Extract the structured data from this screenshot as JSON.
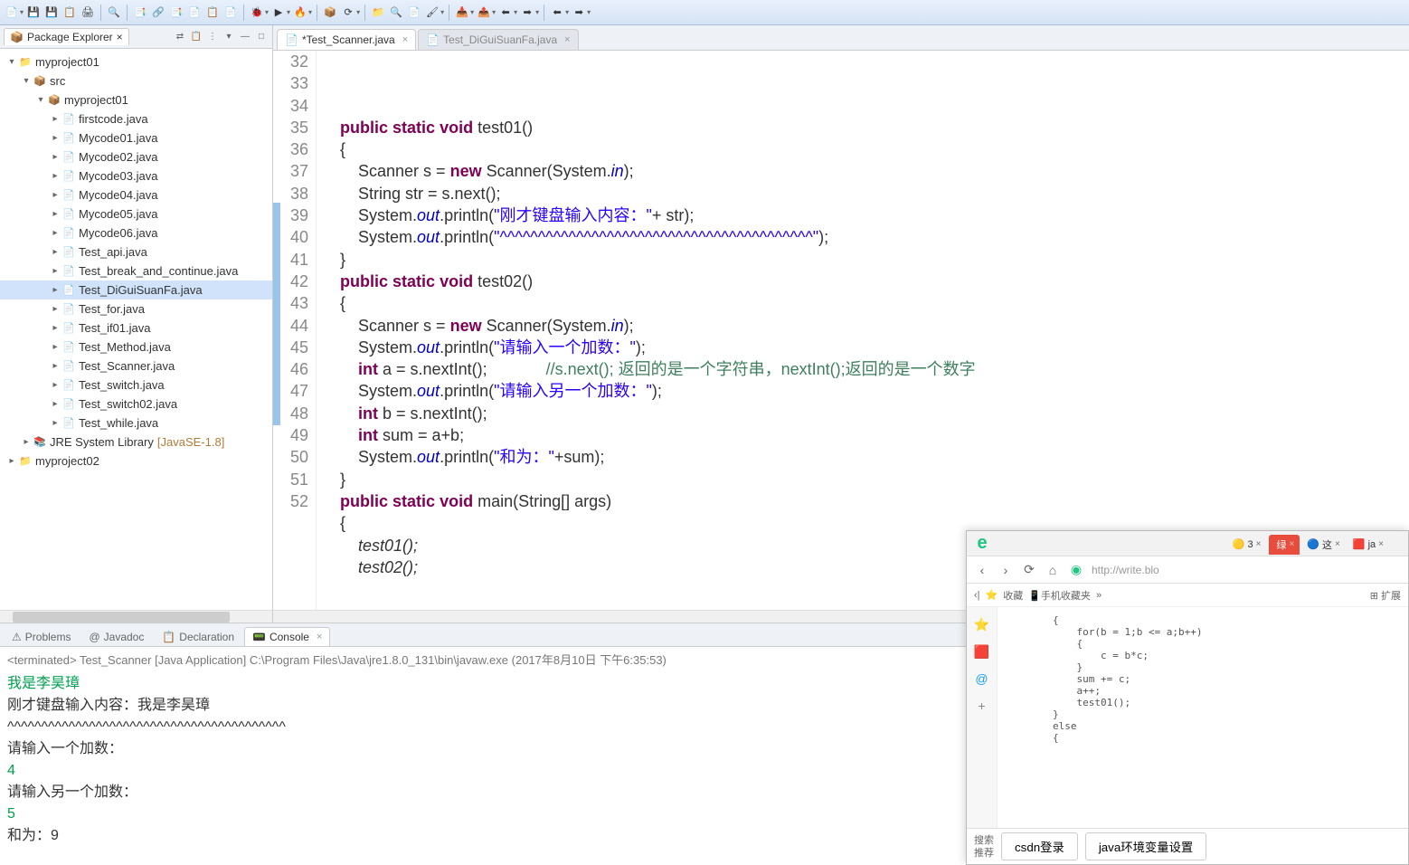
{
  "toolbar_icons": [
    "📄",
    "▾",
    "💾",
    "💾",
    "📋",
    "🖨",
    "",
    "🔍",
    "",
    "📑",
    "🔗",
    "📑",
    "📄",
    "📋",
    "📄",
    "",
    "🐞",
    "▾",
    "▶",
    "▾",
    "🔥",
    "▾",
    "",
    "📦",
    "⟳",
    "▾",
    "",
    "📁",
    "🔍",
    "📄",
    "🖌",
    "▾",
    "",
    "📥",
    "▾",
    "📤",
    "▾",
    "⬅",
    "▾",
    "➡",
    "▾",
    "",
    "⬅",
    "▾",
    "➡",
    "▾"
  ],
  "packageExplorer": {
    "title": "Package Explorer",
    "tools": [
      "⇄",
      "📋",
      "⋮",
      "▾",
      "—",
      "□"
    ]
  },
  "tree": [
    {
      "d": 0,
      "tw": "▾",
      "ic": "📁",
      "cls": "proj",
      "lbl": "myproject01"
    },
    {
      "d": 1,
      "tw": "▾",
      "ic": "📦",
      "cls": "pkg",
      "lbl": "src"
    },
    {
      "d": 2,
      "tw": "▾",
      "ic": "📦",
      "cls": "pkg",
      "lbl": "myproject01"
    },
    {
      "d": 3,
      "tw": "▸",
      "ic": "📄",
      "cls": "java",
      "lbl": "firstcode.java"
    },
    {
      "d": 3,
      "tw": "▸",
      "ic": "📄",
      "cls": "java",
      "lbl": "Mycode01.java"
    },
    {
      "d": 3,
      "tw": "▸",
      "ic": "📄",
      "cls": "java",
      "lbl": "Mycode02.java"
    },
    {
      "d": 3,
      "tw": "▸",
      "ic": "📄",
      "cls": "java",
      "lbl": "Mycode03.java"
    },
    {
      "d": 3,
      "tw": "▸",
      "ic": "📄",
      "cls": "java",
      "lbl": "Mycode04.java"
    },
    {
      "d": 3,
      "tw": "▸",
      "ic": "📄",
      "cls": "java",
      "lbl": "Mycode05.java"
    },
    {
      "d": 3,
      "tw": "▸",
      "ic": "📄",
      "cls": "java",
      "lbl": "Mycode06.java"
    },
    {
      "d": 3,
      "tw": "▸",
      "ic": "📄",
      "cls": "java",
      "lbl": "Test_api.java"
    },
    {
      "d": 3,
      "tw": "▸",
      "ic": "📄",
      "cls": "java",
      "lbl": "Test_break_and_continue.java"
    },
    {
      "d": 3,
      "tw": "▸",
      "ic": "📄",
      "cls": "java",
      "lbl": "Test_DiGuiSuanFa.java",
      "sel": true
    },
    {
      "d": 3,
      "tw": "▸",
      "ic": "📄",
      "cls": "java",
      "lbl": "Test_for.java"
    },
    {
      "d": 3,
      "tw": "▸",
      "ic": "📄",
      "cls": "java",
      "lbl": "Test_if01.java"
    },
    {
      "d": 3,
      "tw": "▸",
      "ic": "📄",
      "cls": "java",
      "lbl": "Test_Method.java"
    },
    {
      "d": 3,
      "tw": "▸",
      "ic": "📄",
      "cls": "java",
      "lbl": "Test_Scanner.java"
    },
    {
      "d": 3,
      "tw": "▸",
      "ic": "📄",
      "cls": "java",
      "lbl": "Test_switch.java"
    },
    {
      "d": 3,
      "tw": "▸",
      "ic": "📄",
      "cls": "java",
      "lbl": "Test_switch02.java"
    },
    {
      "d": 3,
      "tw": "▸",
      "ic": "📄",
      "cls": "java",
      "lbl": "Test_while.java"
    },
    {
      "d": 1,
      "tw": "▸",
      "ic": "📚",
      "cls": "lib",
      "lbl": "JRE System Library",
      "suffix": "[JavaSE-1.8]"
    },
    {
      "d": 0,
      "tw": "▸",
      "ic": "📁",
      "cls": "proj",
      "lbl": "myproject02"
    }
  ],
  "editorTabs": [
    {
      "label": "*Test_Scanner.java",
      "active": true
    },
    {
      "label": "Test_DiGuiSuanFa.java",
      "active": false
    }
  ],
  "code": {
    "lines": [
      32,
      33,
      34,
      35,
      36,
      37,
      38,
      39,
      40,
      41,
      42,
      43,
      44,
      45,
      46,
      47,
      48,
      49,
      50,
      51,
      52
    ],
    "l32": {
      "kw1": "public",
      "kw2": "static",
      "kw3": "void",
      "name": " test01()"
    },
    "l33": "    {",
    "l34": {
      "pre": "        Scanner s = ",
      "kw": "new",
      "mid": " Scanner(System.",
      "fld": "in",
      "end": ");"
    },
    "l35": "        String str = s.next();",
    "l36": {
      "pre": "        System.",
      "fld": "out",
      "mid": ".println(",
      "str": "\"刚才键盘输入内容：\"",
      "end": "+ str);"
    },
    "l37": {
      "pre": "        System.",
      "fld": "out",
      "mid": ".println(",
      "str": "\"^^^^^^^^^^^^^^^^^^^^^^^^^^^^^^^^^^^^^^^^^\"",
      "end": ");"
    },
    "l38": "    }",
    "l39": {
      "kw1": "public",
      "kw2": "static",
      "kw3": "void",
      "name": " test02()"
    },
    "l40": "    {",
    "l41": {
      "pre": "        Scanner s = ",
      "kw": "new",
      "mid": " Scanner(System.",
      "fld": "in",
      "end": ");"
    },
    "l42": {
      "pre": "        System.",
      "fld": "out",
      "mid": ".println(",
      "str": "\"请输入一个加数：\"",
      "end": ");"
    },
    "l43": {
      "pre": "        ",
      "kw": "int",
      "mid": " a = s.nextInt();",
      "sp": "             ",
      "cmt": "//s.next(); 返回的是一个字符串，nextInt();返回的是一个数字"
    },
    "l44": {
      "pre": "        System.",
      "fld": "out",
      "mid": ".println(",
      "str": "\"请输入另一个加数：\"",
      "end": ");"
    },
    "l45": {
      "pre": "        ",
      "kw": "int",
      "end": " b = s.nextInt();"
    },
    "l46": {
      "pre": "        ",
      "kw": "int",
      "end": " sum = a+b;"
    },
    "l47": {
      "pre": "        System.",
      "fld": "out",
      "mid": ".println(",
      "str": "\"和为：\"",
      "end": "+sum);"
    },
    "l48": "    }",
    "l49": {
      "kw1": "public",
      "kw2": "static",
      "kw3": "void",
      "name": " main(String[] args)"
    },
    "l50": "    {",
    "l51": "        test01();",
    "l52": "        test02();"
  },
  "bottomTabs": [
    {
      "label": "Problems",
      "icon": "⚠"
    },
    {
      "label": "Javadoc",
      "icon": "@"
    },
    {
      "label": "Declaration",
      "icon": "📋"
    },
    {
      "label": "Console",
      "icon": "📟",
      "active": true
    }
  ],
  "console": {
    "info": "<terminated> Test_Scanner [Java Application] C:\\Program Files\\Java\\jre1.8.0_131\\bin\\javaw.exe (2017年8月10日 下午6:35:53)",
    "lines": [
      {
        "t": "我是李昊璋",
        "in": true
      },
      {
        "t": "刚才键盘输入内容：我是李昊璋"
      },
      {
        "t": "^^^^^^^^^^^^^^^^^^^^^^^^^^^^^^^^^^^^^^^^^"
      },
      {
        "t": "请输入一个加数："
      },
      {
        "t": "4",
        "in": true
      },
      {
        "t": "请输入另一个加数："
      },
      {
        "t": "5",
        "in": true
      },
      {
        "t": "和为：9"
      }
    ]
  },
  "browser": {
    "tabs": [
      {
        "ic": "🟡",
        "lbl": "3",
        "x": "×"
      },
      {
        "ic": "",
        "lbl": "绿",
        "x": "×",
        "cls": "red"
      },
      {
        "ic": "🔵",
        "lbl": "这",
        "x": "×"
      },
      {
        "ic": "🟥",
        "lbl": "ja",
        "x": "×"
      },
      {
        "ic": "",
        "lbl": "",
        "x": "",
        "last": true
      }
    ],
    "url": "http://write.blo",
    "fav": {
      "star": "⭐",
      "favlbl": "收藏",
      "phone": "📱手机收藏夹",
      "more": "»",
      "ext": "⊞ 扩展"
    },
    "side": [
      "⭐",
      "🟥",
      "@",
      "+"
    ],
    "sideColors": [
      "#f5b301",
      "#e74c3c",
      "#1da1f2",
      "#888"
    ],
    "snippet": "        {\n            for(b = 1;b <= a;b++)\n            {\n                c = b*c;\n            }\n            sum += c;\n            a++;\n            test01();\n        }\n        else\n        {",
    "bottom": {
      "lbl": "搜索\n推荐",
      "btn1": "csdn登录",
      "btn2": "java环境变量设置"
    }
  }
}
